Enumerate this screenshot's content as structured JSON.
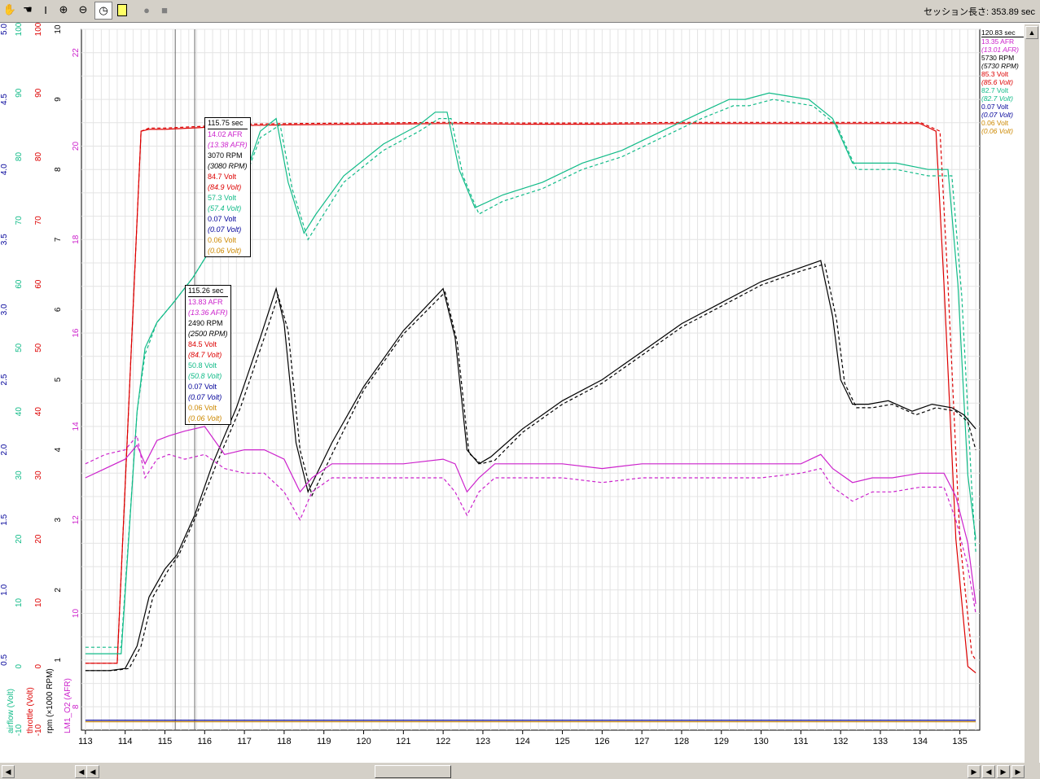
{
  "toolbar": {
    "tools": [
      "hand-icon",
      "grab-icon",
      "text-cursor-icon",
      "zoom-in-icon",
      "zoom-out-icon",
      "gauge-icon",
      "notes-icon",
      "record-icon",
      "stop-icon"
    ],
    "session_label": "セッション長さ: 353.89 sec"
  },
  "colors": {
    "afr": "#cc22cc",
    "rpm": "#000000",
    "throttle": "#dd0000",
    "airflow": "#11bb88",
    "volt_blue": "#000099",
    "volt_orange": "#cc8800"
  },
  "tooltips": [
    {
      "time": "115.75 sec",
      "rows": [
        {
          "text": "14.02 AFR",
          "color": "afr",
          "italic": false
        },
        {
          "text": "(13.38 AFR)",
          "color": "afr",
          "italic": true
        },
        {
          "text": "3070 RPM",
          "color": "rpm",
          "italic": false
        },
        {
          "text": "(3080 RPM)",
          "color": "rpm",
          "italic": true
        },
        {
          "text": "84.7 Volt",
          "color": "throttle",
          "italic": false
        },
        {
          "text": "(84.9 Volt)",
          "color": "throttle",
          "italic": true
        },
        {
          "text": "57.3 Volt",
          "color": "airflow",
          "italic": false
        },
        {
          "text": "(57.4 Volt)",
          "color": "airflow",
          "italic": true
        },
        {
          "text": "0.07 Volt",
          "color": "volt_blue",
          "italic": false
        },
        {
          "text": "(0.07 Volt)",
          "color": "volt_blue",
          "italic": true
        },
        {
          "text": "0.06 Volt",
          "color": "volt_orange",
          "italic": false
        },
        {
          "text": "(0.06 Volt)",
          "color": "volt_orange",
          "italic": true
        }
      ]
    },
    {
      "time": "115.26 sec",
      "rows": [
        {
          "text": "13.83 AFR",
          "color": "afr",
          "italic": false
        },
        {
          "text": "(13.36 AFR)",
          "color": "afr",
          "italic": true
        },
        {
          "text": "2490 RPM",
          "color": "rpm",
          "italic": false
        },
        {
          "text": "(2500 RPM)",
          "color": "rpm",
          "italic": true
        },
        {
          "text": "84.5 Volt",
          "color": "throttle",
          "italic": false
        },
        {
          "text": "(84.7 Volt)",
          "color": "throttle",
          "italic": true
        },
        {
          "text": "50.8 Volt",
          "color": "airflow",
          "italic": false
        },
        {
          "text": "(50.8 Volt)",
          "color": "airflow",
          "italic": true
        },
        {
          "text": "0.07 Volt",
          "color": "volt_blue",
          "italic": false
        },
        {
          "text": "(0.07 Volt)",
          "color": "volt_blue",
          "italic": true
        },
        {
          "text": "0.06 Volt",
          "color": "volt_orange",
          "italic": false
        },
        {
          "text": "(0.06 Volt)",
          "color": "volt_orange",
          "italic": true
        }
      ]
    }
  ],
  "cursor_panel": {
    "time": "120.83 sec",
    "rows": [
      {
        "text": "13.35 AFR",
        "color": "afr",
        "italic": false
      },
      {
        "text": "(13.01 AFR)",
        "color": "afr",
        "italic": true
      },
      {
        "text": "5730 RPM",
        "color": "rpm",
        "italic": false
      },
      {
        "text": "(5730 RPM)",
        "color": "rpm",
        "italic": true
      },
      {
        "text": "85.3 Volt",
        "color": "throttle",
        "italic": false
      },
      {
        "text": "(85.6 Volt)",
        "color": "throttle",
        "italic": true
      },
      {
        "text": "82.7 Volt",
        "color": "airflow",
        "italic": false
      },
      {
        "text": "(82.7 Volt)",
        "color": "airflow",
        "italic": true
      },
      {
        "text": "0.07 Volt",
        "color": "volt_blue",
        "italic": false
      },
      {
        "text": "(0.07 Volt)",
        "color": "volt_blue",
        "italic": true
      },
      {
        "text": "0.06 Volt",
        "color": "volt_orange",
        "italic": false
      },
      {
        "text": "(0.06 Volt)",
        "color": "volt_orange",
        "italic": true
      }
    ]
  },
  "chart_data": {
    "type": "line",
    "xlim": [
      112.9,
      135.5
    ],
    "x_ticks": [
      113,
      114,
      115,
      116,
      117,
      118,
      119,
      120,
      121,
      122,
      123,
      124,
      125,
      126,
      127,
      128,
      129,
      130,
      131,
      132,
      133,
      134,
      135
    ],
    "cursors_x": [
      115.26,
      115.75
    ],
    "axes": [
      {
        "name": "LM1_O2 (AFR)",
        "color": "afr",
        "lim": [
          7.5,
          22.5
        ],
        "ticks": [
          8,
          10,
          12,
          14,
          16,
          18,
          20,
          22
        ]
      },
      {
        "name": "rpm (×1000 RPM)",
        "color": "rpm",
        "lim": [
          0,
          10
        ],
        "ticks": [
          1,
          2,
          3,
          4,
          5,
          6,
          7,
          8,
          9,
          10
        ]
      },
      {
        "name": "throttle (Volt)",
        "color": "throttle",
        "lim": [
          -10,
          100
        ],
        "ticks": [
          -10,
          0,
          10,
          20,
          30,
          40,
          50,
          60,
          70,
          80,
          90,
          100
        ]
      },
      {
        "name": "airflow (Volt)",
        "color": "airflow",
        "lim": [
          -10,
          100
        ],
        "ticks": [
          -10,
          0,
          10,
          20,
          30,
          40,
          50,
          60,
          70,
          80,
          90,
          100
        ]
      },
      {
        "name": "",
        "color": "volt_blue",
        "lim": [
          0,
          5
        ],
        "ticks": [
          0.5,
          1.0,
          1.5,
          2.0,
          2.5,
          3.0,
          3.5,
          4.0,
          4.5,
          5.0
        ]
      }
    ],
    "series": [
      {
        "name": "throttle",
        "axis": 2,
        "color": "throttle",
        "dashed": false,
        "x": [
          113,
          113.8,
          114.4,
          114.6,
          115,
          116,
          117,
          118,
          120,
          122,
          124,
          126,
          128,
          130,
          131.5,
          134,
          134.4,
          134.6,
          134.9,
          135.2,
          135.4
        ],
        "y": [
          0.5,
          0.5,
          84,
          84.3,
          84.3,
          84.6,
          84.9,
          85.0,
          85.1,
          85.2,
          85.1,
          85.1,
          85.2,
          85.2,
          85.2,
          85.2,
          84,
          60,
          20,
          0,
          -1
        ]
      },
      {
        "name": "throttle",
        "axis": 2,
        "color": "throttle",
        "dashed": true,
        "x": [
          113,
          113.8,
          114.4,
          114.6,
          115,
          116,
          117,
          118,
          120,
          122,
          124,
          126,
          128,
          130,
          131.5,
          134,
          134.5,
          134.7,
          135,
          135.3,
          135.4
        ],
        "y": [
          0.5,
          0.5,
          84,
          84.5,
          84.5,
          84.8,
          85.1,
          85.2,
          85.3,
          85.4,
          85.3,
          85.3,
          85.4,
          85.4,
          85.4,
          85.4,
          84,
          60,
          20,
          2,
          1
        ]
      },
      {
        "name": "airflow",
        "axis": 3,
        "color": "airflow",
        "dashed": false,
        "x": [
          113,
          113.9,
          114.3,
          114.5,
          114.8,
          115.2,
          115.7,
          116.2,
          116.8,
          117.4,
          117.8,
          118.1,
          118.5,
          118.8,
          119.5,
          120.5,
          121.4,
          121.8,
          122.1,
          122.4,
          122.8,
          123.5,
          124.5,
          125.5,
          126.5,
          127.5,
          128.5,
          129.2,
          129.6,
          130.2,
          131.2,
          131.8,
          132.3,
          132.8,
          133.4,
          134.2,
          134.7,
          134.95,
          135.2,
          135.4
        ],
        "y": [
          2,
          2,
          40,
          50,
          54,
          57,
          61,
          66,
          73,
          84,
          86,
          76,
          68,
          71,
          77,
          82,
          85,
          87,
          87,
          78,
          72,
          74,
          76,
          79,
          81,
          84,
          87,
          89,
          89,
          90,
          89,
          86,
          79,
          79,
          79,
          78,
          78,
          60,
          30,
          20
        ]
      },
      {
        "name": "airflow",
        "axis": 3,
        "color": "airflow",
        "dashed": true,
        "x": [
          113,
          113.9,
          114.3,
          114.5,
          114.8,
          115.2,
          115.7,
          116.2,
          116.8,
          117.4,
          117.9,
          118.2,
          118.6,
          118.9,
          119.5,
          120.5,
          121.4,
          121.9,
          122.2,
          122.5,
          122.9,
          123.5,
          124.5,
          125.5,
          126.5,
          127.5,
          128.5,
          129.3,
          129.7,
          130.3,
          131.3,
          131.9,
          132.4,
          132.9,
          133.4,
          134.2,
          134.8,
          135.05,
          135.3,
          135.4
        ],
        "y": [
          3,
          3,
          40,
          49,
          54,
          57,
          61,
          66,
          73,
          83,
          85,
          75,
          67,
          70,
          76,
          81,
          84,
          86,
          86,
          77,
          71,
          73,
          75,
          78,
          80,
          83,
          86,
          88,
          88,
          89,
          88,
          85,
          78,
          78,
          78,
          77,
          77,
          58,
          28,
          18
        ]
      },
      {
        "name": "rpm",
        "axis": 1,
        "color": "rpm",
        "dashed": false,
        "x": [
          113,
          113.6,
          114.0,
          114.3,
          114.6,
          115.0,
          115.3,
          115.75,
          116.2,
          116.8,
          117.4,
          117.8,
          118.0,
          118.3,
          118.6,
          119.2,
          120.0,
          121.0,
          122.0,
          122.3,
          122.6,
          122.9,
          123.2,
          124.0,
          125.0,
          126.0,
          127.0,
          128.0,
          129.0,
          130.0,
          131.0,
          131.5,
          131.8,
          132.0,
          132.3,
          132.7,
          133.2,
          133.8,
          134.3,
          134.8,
          135.1,
          135.4
        ],
        "y": [
          0.85,
          0.85,
          0.88,
          1.2,
          1.9,
          2.3,
          2.5,
          3.07,
          3.8,
          4.6,
          5.6,
          6.3,
          5.8,
          4.1,
          3.4,
          4.1,
          4.9,
          5.7,
          6.3,
          5.6,
          4.0,
          3.8,
          3.9,
          4.3,
          4.7,
          5.0,
          5.4,
          5.8,
          6.1,
          6.4,
          6.6,
          6.7,
          5.9,
          5.0,
          4.65,
          4.65,
          4.7,
          4.55,
          4.65,
          4.6,
          4.5,
          4.3
        ]
      },
      {
        "name": "rpm",
        "axis": 1,
        "color": "rpm",
        "dashed": true,
        "x": [
          113,
          113.7,
          114.1,
          114.4,
          114.7,
          115.1,
          115.35,
          115.8,
          116.3,
          116.9,
          117.5,
          117.85,
          118.1,
          118.4,
          118.7,
          119.3,
          120.0,
          121.0,
          122.05,
          122.35,
          122.65,
          122.95,
          123.3,
          124.0,
          125.0,
          126.0,
          127.0,
          128.0,
          129.0,
          130.0,
          131.0,
          131.6,
          131.9,
          132.1,
          132.4,
          132.8,
          133.3,
          133.9,
          134.4,
          134.9,
          135.2,
          135.4
        ],
        "y": [
          0.85,
          0.85,
          0.88,
          1.2,
          1.9,
          2.3,
          2.5,
          3.08,
          3.8,
          4.6,
          5.6,
          6.2,
          5.7,
          4.0,
          3.35,
          4.05,
          4.85,
          5.65,
          6.25,
          5.55,
          3.95,
          3.8,
          3.85,
          4.25,
          4.65,
          4.95,
          5.35,
          5.75,
          6.05,
          6.35,
          6.55,
          6.65,
          5.85,
          4.95,
          4.6,
          4.6,
          4.65,
          4.5,
          4.6,
          4.55,
          4.4,
          4.0
        ]
      },
      {
        "name": "LM1_O2",
        "axis": 0,
        "color": "afr",
        "dashed": false,
        "x": [
          113,
          113.5,
          114.0,
          114.3,
          114.5,
          114.8,
          115.1,
          115.5,
          116.0,
          116.5,
          117.0,
          117.5,
          118.0,
          118.4,
          118.7,
          119.2,
          120.0,
          121.0,
          122.0,
          122.3,
          122.6,
          122.9,
          123.3,
          124.0,
          125.0,
          126.0,
          127.0,
          128.0,
          129.0,
          130.0,
          131.0,
          131.5,
          131.8,
          132.3,
          132.8,
          133.3,
          134.0,
          134.6,
          134.9,
          135.2,
          135.4
        ],
        "y": [
          12.9,
          13.1,
          13.3,
          13.6,
          13.2,
          13.7,
          13.8,
          13.9,
          14.0,
          13.4,
          13.5,
          13.5,
          13.3,
          12.6,
          12.9,
          13.2,
          13.2,
          13.2,
          13.3,
          13.2,
          12.6,
          12.9,
          13.2,
          13.2,
          13.2,
          13.1,
          13.2,
          13.2,
          13.2,
          13.2,
          13.2,
          13.4,
          13.1,
          12.8,
          12.9,
          12.9,
          13.0,
          13.0,
          12.5,
          11.5,
          10.2
        ]
      },
      {
        "name": "LM1_O2",
        "axis": 0,
        "color": "afr",
        "dashed": true,
        "x": [
          113,
          113.5,
          114.0,
          114.3,
          114.5,
          114.8,
          115.1,
          115.5,
          116.0,
          116.5,
          117.0,
          117.5,
          118.0,
          118.4,
          118.7,
          119.2,
          120.0,
          121.0,
          122.0,
          122.3,
          122.6,
          122.9,
          123.3,
          124.0,
          125.0,
          126.0,
          127.0,
          128.0,
          129.0,
          130.0,
          131.0,
          131.5,
          131.8,
          132.3,
          132.8,
          133.3,
          134.0,
          134.6,
          134.9,
          135.2,
          135.4
        ],
        "y": [
          13.2,
          13.4,
          13.5,
          13.8,
          12.9,
          13.3,
          13.4,
          13.3,
          13.4,
          13.1,
          13.0,
          13.0,
          12.6,
          12.0,
          12.6,
          12.9,
          12.9,
          12.9,
          12.9,
          12.6,
          12.1,
          12.6,
          12.9,
          12.9,
          12.9,
          12.8,
          12.9,
          12.9,
          12.9,
          12.9,
          13.0,
          13.1,
          12.7,
          12.4,
          12.6,
          12.6,
          12.7,
          12.7,
          12.0,
          11.0,
          10.0
        ]
      },
      {
        "name": "volt_blue",
        "axis": 4,
        "color": "volt_blue",
        "dashed": false,
        "x": [
          113,
          135.4
        ],
        "y": [
          0.07,
          0.07
        ]
      },
      {
        "name": "volt_orange",
        "axis": 4,
        "color": "volt_orange",
        "dashed": false,
        "x": [
          113,
          135.4
        ],
        "y": [
          0.06,
          0.06
        ]
      }
    ]
  }
}
